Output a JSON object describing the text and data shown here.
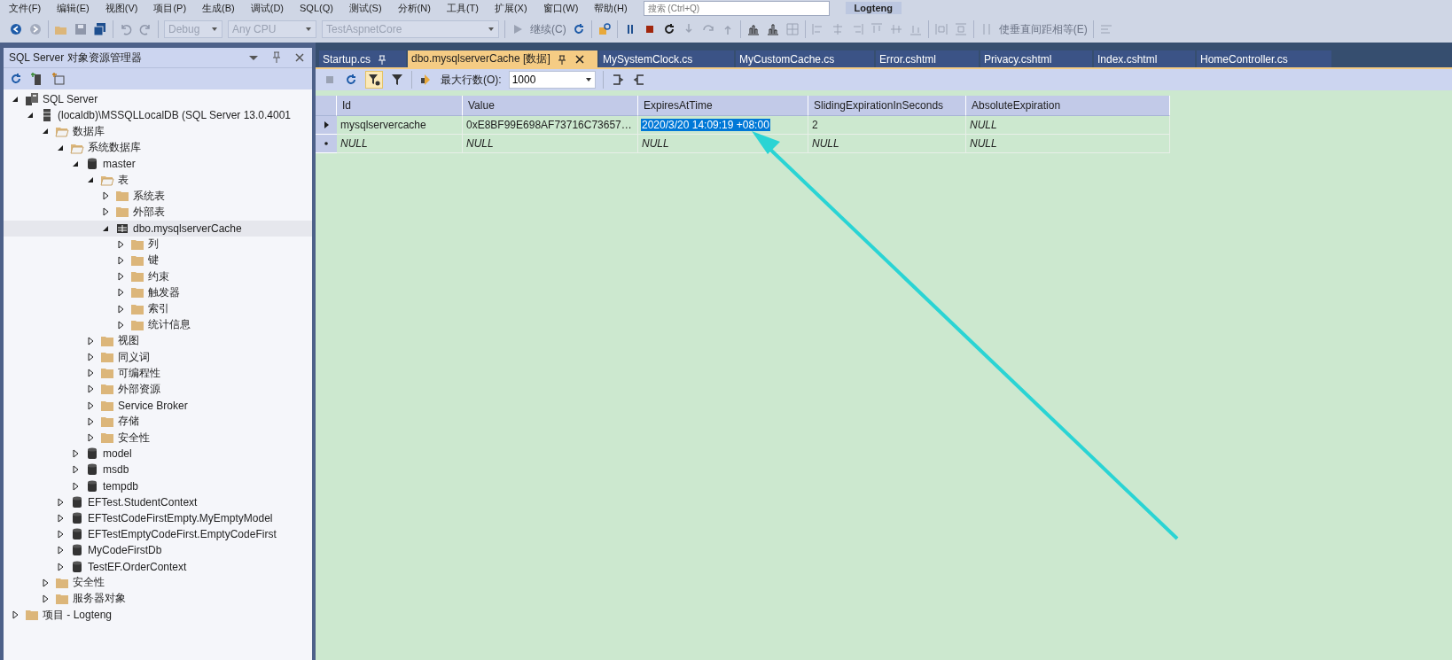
{
  "menu_bar": {
    "items": [
      "文件(F)",
      "编辑(E)",
      "视图(V)",
      "项目(P)",
      "生成(B)",
      "调试(D)",
      "SQL(Q)",
      "测试(S)",
      "分析(N)",
      "工具(T)",
      "扩展(X)",
      "窗口(W)",
      "帮助(H)"
    ],
    "search": {
      "placeholder": "搜索 (Ctrl+Q)"
    },
    "solution": "Logteng"
  },
  "toolbar": {
    "combos": [
      {
        "value": "Debug",
        "disabled": true
      },
      {
        "value": "Any CPU",
        "disabled": true
      },
      {
        "value": "TestAspnetCore",
        "disabled": true
      }
    ],
    "continue_label": "继续(C)",
    "spacing_label": "使垂直间距相等(E)"
  },
  "explorer": {
    "title": "SQL Server 对象资源管理器",
    "tree": [
      {
        "label": "SQL Server",
        "kind": "servers",
        "expanded": true,
        "selected": false,
        "children": [
          {
            "label": "(localdb)\\MSSQLLocalDB (SQL Server 13.0.4001",
            "kind": "server",
            "expanded": true,
            "selected": false,
            "children": [
              {
                "label": "数据库",
                "kind": "openfolder",
                "expanded": true,
                "selected": false,
                "children": [
                  {
                    "label": "系统数据库",
                    "kind": "openfolder",
                    "expanded": true,
                    "selected": false,
                    "children": [
                      {
                        "label": "master",
                        "kind": "database",
                        "expanded": true,
                        "selected": false,
                        "children": [
                          {
                            "label": "表",
                            "kind": "openfolder",
                            "expanded": true,
                            "selected": false,
                            "children": [
                              {
                                "label": "系统表",
                                "kind": "folder",
                                "expanded": false,
                                "selected": false
                              },
                              {
                                "label": "外部表",
                                "kind": "folder",
                                "expanded": false,
                                "selected": false
                              },
                              {
                                "label": "dbo.mysqlserverCache",
                                "kind": "table",
                                "expanded": true,
                                "selected": true,
                                "children": [
                                  {
                                    "label": "列",
                                    "kind": "folder",
                                    "expanded": false,
                                    "selected": false
                                  },
                                  {
                                    "label": "键",
                                    "kind": "folder",
                                    "expanded": false,
                                    "selected": false
                                  },
                                  {
                                    "label": "约束",
                                    "kind": "folder",
                                    "expanded": false,
                                    "selected": false
                                  },
                                  {
                                    "label": "触发器",
                                    "kind": "folder",
                                    "expanded": false,
                                    "selected": false
                                  },
                                  {
                                    "label": "索引",
                                    "kind": "folder",
                                    "expanded": false,
                                    "selected": false
                                  },
                                  {
                                    "label": "统计信息",
                                    "kind": "folder",
                                    "expanded": false,
                                    "selected": false
                                  }
                                ]
                              }
                            ]
                          },
                          {
                            "label": "视图",
                            "kind": "folder",
                            "expanded": false,
                            "selected": false
                          },
                          {
                            "label": "同义词",
                            "kind": "folder",
                            "expanded": false,
                            "selected": false
                          },
                          {
                            "label": "可编程性",
                            "kind": "folder",
                            "expanded": false,
                            "selected": false
                          },
                          {
                            "label": "外部资源",
                            "kind": "folder",
                            "expanded": false,
                            "selected": false
                          },
                          {
                            "label": "Service Broker",
                            "kind": "folder",
                            "expanded": false,
                            "selected": false
                          },
                          {
                            "label": "存储",
                            "kind": "folder",
                            "expanded": false,
                            "selected": false
                          },
                          {
                            "label": "安全性",
                            "kind": "folder",
                            "expanded": false,
                            "selected": false
                          }
                        ]
                      },
                      {
                        "label": "model",
                        "kind": "database",
                        "expanded": false,
                        "selected": false
                      },
                      {
                        "label": "msdb",
                        "kind": "database",
                        "expanded": false,
                        "selected": false
                      },
                      {
                        "label": "tempdb",
                        "kind": "database",
                        "expanded": false,
                        "selected": false
                      }
                    ]
                  },
                  {
                    "label": "EFTest.StudentContext",
                    "kind": "database",
                    "expanded": false,
                    "selected": false
                  },
                  {
                    "label": "EFTestCodeFirstEmpty.MyEmptyModel",
                    "kind": "database",
                    "expanded": false,
                    "selected": false
                  },
                  {
                    "label": "EFTestEmptyCodeFirst.EmptyCodeFirst",
                    "kind": "database",
                    "expanded": false,
                    "selected": false
                  },
                  {
                    "label": "MyCodeFirstDb",
                    "kind": "database",
                    "expanded": false,
                    "selected": false
                  },
                  {
                    "label": "TestEF.OrderContext",
                    "kind": "database",
                    "expanded": false,
                    "selected": false
                  }
                ]
              },
              {
                "label": "安全性",
                "kind": "folder",
                "expanded": false,
                "selected": false
              },
              {
                "label": "服务器对象",
                "kind": "folder",
                "expanded": false,
                "selected": false
              }
            ]
          }
        ]
      },
      {
        "label": "项目 - Logteng",
        "kind": "folder",
        "expanded": false,
        "selected": false
      }
    ]
  },
  "tabs": [
    {
      "label": "Startup.cs",
      "selected": false,
      "pinned": true
    },
    {
      "label": "dbo.mysqlserverCache [数据]",
      "selected": true,
      "pinned": true
    },
    {
      "label": "MySystemClock.cs",
      "selected": false,
      "pinned": false
    },
    {
      "label": "MyCustomCache.cs",
      "selected": false,
      "pinned": false
    },
    {
      "label": "Error.cshtml",
      "selected": false,
      "pinned": false
    },
    {
      "label": "Privacy.cshtml",
      "selected": false,
      "pinned": false
    },
    {
      "label": "Index.cshtml",
      "selected": false,
      "pinned": false
    },
    {
      "label": "HomeController.cs",
      "selected": false,
      "pinned": false
    }
  ],
  "data_toolbar": {
    "filter_on": true,
    "max_rows_label": "最大行数(O):",
    "max_rows": "1000"
  },
  "grid": {
    "columns": [
      "Id",
      "Value",
      "ExpiresAtTime",
      "SlidingExpirationInSeconds",
      "AbsoluteExpiration"
    ],
    "rows": [
      {
        "kind": "current",
        "cells": [
          {
            "text": "mysqlservercache",
            "is_null": false,
            "selected": false
          },
          {
            "text": "0xE8BF99E698AF73716C73657…",
            "is_null": false,
            "selected": false
          },
          {
            "text": "2020/3/20 14:09:19 +08:00",
            "is_null": false,
            "selected": true
          },
          {
            "text": "2",
            "is_null": false,
            "selected": false
          },
          {
            "text": "NULL",
            "is_null": true,
            "selected": false
          }
        ]
      },
      {
        "kind": "new",
        "cells": [
          {
            "text": "NULL",
            "is_null": true,
            "selected": false
          },
          {
            "text": "NULL",
            "is_null": true,
            "selected": false
          },
          {
            "text": "NULL",
            "is_null": true,
            "selected": false
          },
          {
            "text": "NULL",
            "is_null": true,
            "selected": false
          },
          {
            "text": "NULL",
            "is_null": true,
            "selected": false
          }
        ]
      }
    ]
  }
}
